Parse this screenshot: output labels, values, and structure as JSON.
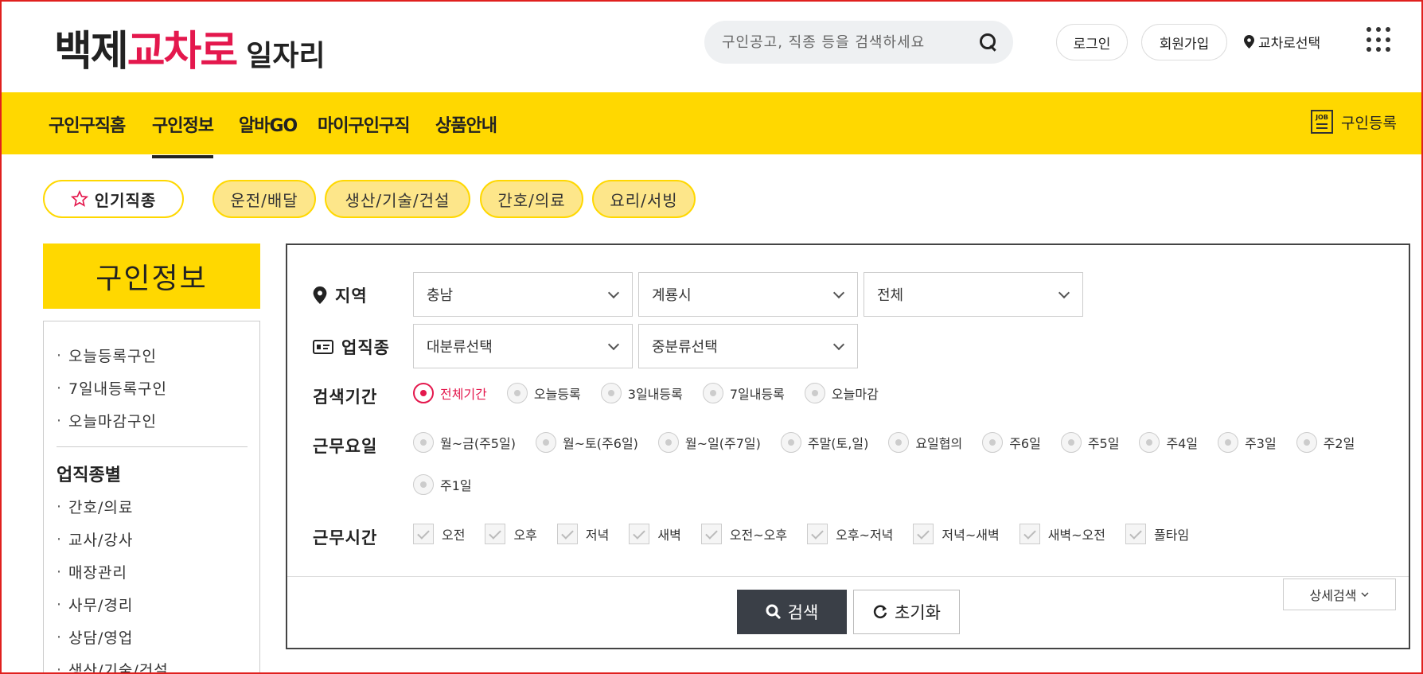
{
  "header": {
    "logo_part1": "백제",
    "logo_part2": "교차로",
    "logo_part3": "일자리",
    "search_placeholder": "구인공고, 직종 등을 검색하세요",
    "login": "로그인",
    "signup": "회원가입",
    "region_select": "교차로선택"
  },
  "nav": {
    "items": [
      "구인구직홈",
      "구인정보",
      "알바GO",
      "마이구인구직",
      "상품안내"
    ],
    "active": "구인정보",
    "register": "구인등록",
    "job_icon_text": "JOB"
  },
  "chips": {
    "popular": "인기직종",
    "categories": [
      "운전/배달",
      "생산/기술/건설",
      "간호/의료",
      "요리/서빙"
    ]
  },
  "sidebar": {
    "title": "구인정보",
    "quick": [
      "오늘등록구인",
      "7일내등록구인",
      "오늘마감구인"
    ],
    "section_title": "업직종별",
    "jobs": [
      "간호/의료",
      "교사/강사",
      "매장관리",
      "사무/경리",
      "상담/영업",
      "생산/기술/건설"
    ]
  },
  "filter": {
    "region_label": "지역",
    "region_values": [
      "충남",
      "계룡시",
      "전체"
    ],
    "job_label": "업직종",
    "job_values": [
      "대분류선택",
      "중분류선택"
    ],
    "period_label": "검색기간",
    "period_options": [
      "전체기간",
      "오늘등록",
      "3일내등록",
      "7일내등록",
      "오늘마감"
    ],
    "period_selected": "전체기간",
    "workday_label": "근무요일",
    "workday_options": [
      "월~금(주5일)",
      "월~토(주6일)",
      "월~일(주7일)",
      "주말(토,일)",
      "요일협의",
      "주6일",
      "주5일",
      "주4일",
      "주3일",
      "주2일",
      "주1일"
    ],
    "worktime_label": "근무시간",
    "worktime_options": [
      "오전",
      "오후",
      "저녁",
      "새벽",
      "오전~오후",
      "오후~저녁",
      "저녁~새벽",
      "새벽~오전",
      "풀타임"
    ],
    "search_button": "검색",
    "reset_button": "초기화",
    "detail_button": "상세검색",
    "accent_color": "#e4184d",
    "brand_color": "#ffd800"
  }
}
